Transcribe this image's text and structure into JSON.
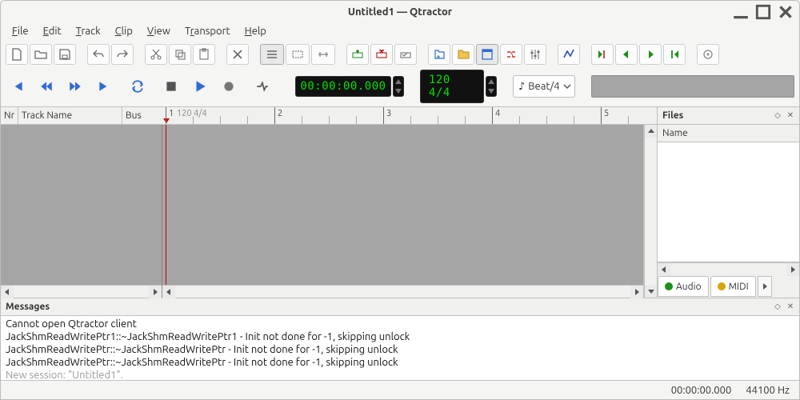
{
  "window_title": "Untitled1 — Qtractor",
  "menu": [
    "File",
    "Edit",
    "Track",
    "Clip",
    "View",
    "Transport",
    "Help"
  ],
  "transport": {
    "time": "00:00:00.000",
    "tempo": "120 4/4",
    "snap": "Beat/4"
  },
  "track_columns": {
    "nr": "Nr",
    "name": "Track Name",
    "bus": "Bus"
  },
  "ruler": {
    "markers": [
      "1",
      "2",
      "3",
      "4",
      "5"
    ],
    "tempo_label": "120 4/4"
  },
  "files": {
    "title": "Files",
    "list_header": "Name",
    "tabs": [
      "Audio",
      "MIDI"
    ]
  },
  "messages": {
    "title": "Messages",
    "lines": [
      "Cannot open Qtractor client",
      "JackShmReadWritePtr1::~JackShmReadWritePtr1 - Init not done for -1, skipping unlock",
      "JackShmReadWritePtr::~JackShmReadWritePtr - Init not done for -1, skipping unlock",
      "JackShmReadWritePtr::~JackShmReadWritePtr - Init not done for -1, skipping unlock"
    ],
    "faded": "New session: \"Untitled1\"."
  },
  "status": {
    "time": "00:00:00.000",
    "sample_rate": "44100 Hz"
  },
  "icons": {
    "note": "♪"
  }
}
